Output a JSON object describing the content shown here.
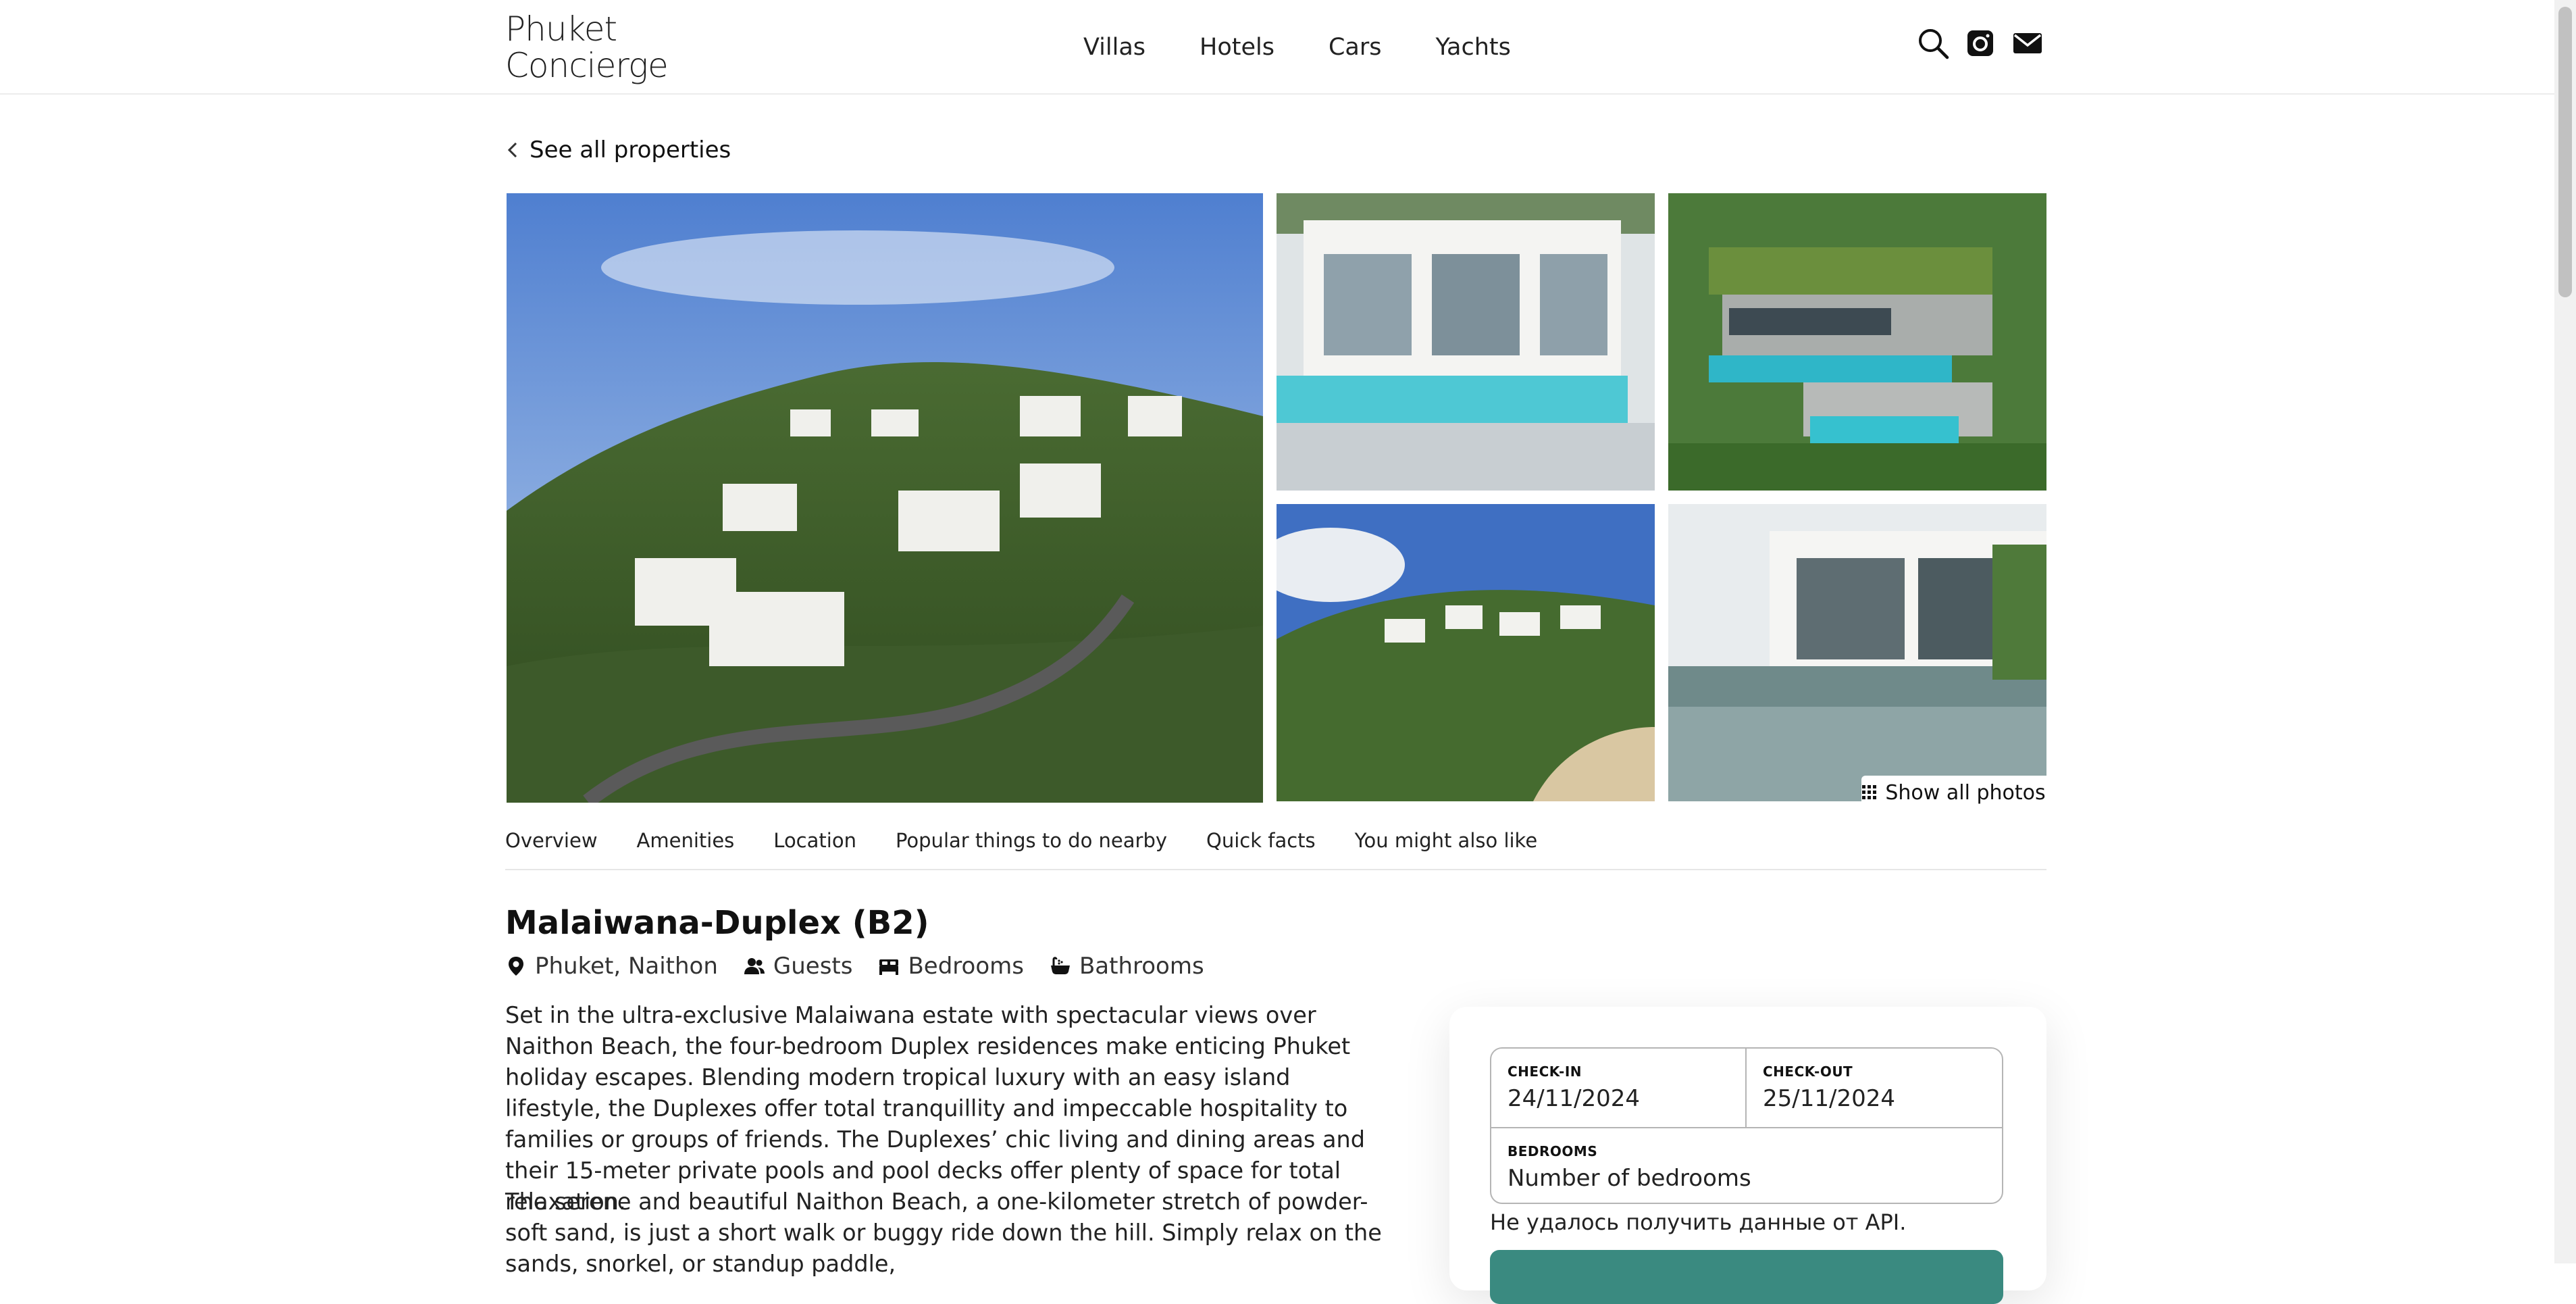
{
  "header": {
    "logo_line1": "Phuket",
    "logo_line2": "Concierge",
    "nav": [
      "Villas",
      "Hotels",
      "Cars",
      "Yachts"
    ],
    "icons": [
      "search-icon",
      "instagram-icon",
      "mail-icon"
    ]
  },
  "back_link": "See all properties",
  "gallery": {
    "show_all_label": "Show all photos"
  },
  "tabs": [
    "Overview",
    "Amenities",
    "Location",
    "Popular things to do nearby",
    "Quick facts",
    "You might also like"
  ],
  "property": {
    "title": "Malaiwana-Duplex (B2)",
    "location": "Phuket, Naithon",
    "guests": "Guests",
    "bedrooms": "Bedrooms",
    "bathrooms": "Bathrooms",
    "description_1": "Set in the ultra-exclusive Malaiwana estate with spectacular views over Naithon Beach, the four-bedroom Duplex residences make enticing Phuket holiday escapes. Blending modern tropical luxury with an easy island lifestyle, the Duplexes offer total tranquillity and impeccable hospitality to families or groups of friends. The Duplexes’ chic living and dining areas and their 15-meter private pools and pool decks offer plenty of space for total relaxation.",
    "description_2": "The serene and beautiful Naithon Beach, a one-kilometer stretch of powder-soft sand, is just a short walk or buggy ride down the hill. Simply relax on the sands, snorkel, or standup paddle,"
  },
  "booking": {
    "checkin_label": "CHECK-IN",
    "checkin_value": "24/11/2024",
    "checkout_label": "CHECK-OUT",
    "checkout_value": "25/11/2024",
    "bedrooms_label": "BEDROOMS",
    "bedrooms_placeholder": "Number of bedrooms",
    "api_error": "Не удалось получить данные от API."
  },
  "colors": {
    "accent": "#3a8a80",
    "border": "#b5b5b5",
    "text": "#222222"
  }
}
